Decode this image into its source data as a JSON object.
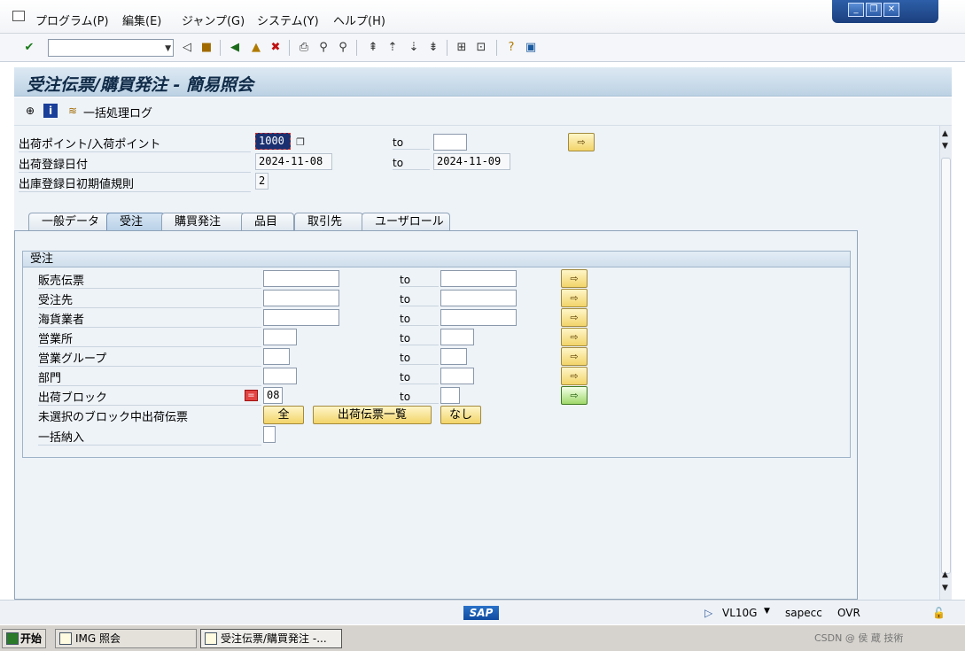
{
  "menu": {
    "items": [
      "プログラム(P)",
      "編集(E)",
      "ジャンプ(G)",
      "システム(Y)",
      "ヘルプ(H)"
    ]
  },
  "window_controls": {
    "minimize": "_",
    "restore": "❐",
    "close": "✕"
  },
  "toolbar": {
    "command_placeholder": ""
  },
  "title": "受注伝票/購買発注 - 簡易照会",
  "app_toolbar": {
    "batch_log_label": "一括処理ログ"
  },
  "header_fields": {
    "shipping_point": {
      "label": "出荷ポイント/入荷ポイント",
      "value": "1000",
      "to_label": "to",
      "to_value": ""
    },
    "reg_date": {
      "label": "出荷登録日付",
      "value": "2024-11-08",
      "to_label": "to",
      "to_value": "2024-11-09"
    },
    "init_rule": {
      "label": "出庫登録日初期値規則",
      "value": "2"
    }
  },
  "tabs": [
    "一般データ",
    "受注",
    "購買発注",
    "品目",
    "取引先",
    "ユーザロール"
  ],
  "active_tab": "受注",
  "group": {
    "title": "受注",
    "rows": [
      {
        "label": "販売伝票",
        "from": "",
        "to_label": "to",
        "to": ""
      },
      {
        "label": "受注先",
        "from": "",
        "to_label": "to",
        "to": ""
      },
      {
        "label": "海貨業者",
        "from": "",
        "to_label": "to",
        "to": ""
      },
      {
        "label": "営業所",
        "from": "",
        "to_label": "to",
        "to": ""
      },
      {
        "label": "営業グループ",
        "from": "",
        "to_label": "to",
        "to": ""
      },
      {
        "label": "部門",
        "from": "",
        "to_label": "to",
        "to": ""
      },
      {
        "label": "出荷ブロック",
        "from": "08",
        "to_label": "to",
        "to": ""
      }
    ],
    "unselected_label": "未選択のブロック中出荷伝票",
    "btn_all": "全",
    "btn_list": "出荷伝票一覧",
    "btn_none": "なし",
    "collective_label": "一括納入",
    "collective_value": ""
  },
  "status": {
    "logo": "SAP",
    "tcode": "VL10G",
    "system": "sapecc",
    "mode": "OVR"
  },
  "taskbar": {
    "start": "开始",
    "items": [
      "IMG 照会",
      "受注伝票/購買発注 -..."
    ],
    "tray": "CSDN @ 侯 蔵 技術"
  }
}
